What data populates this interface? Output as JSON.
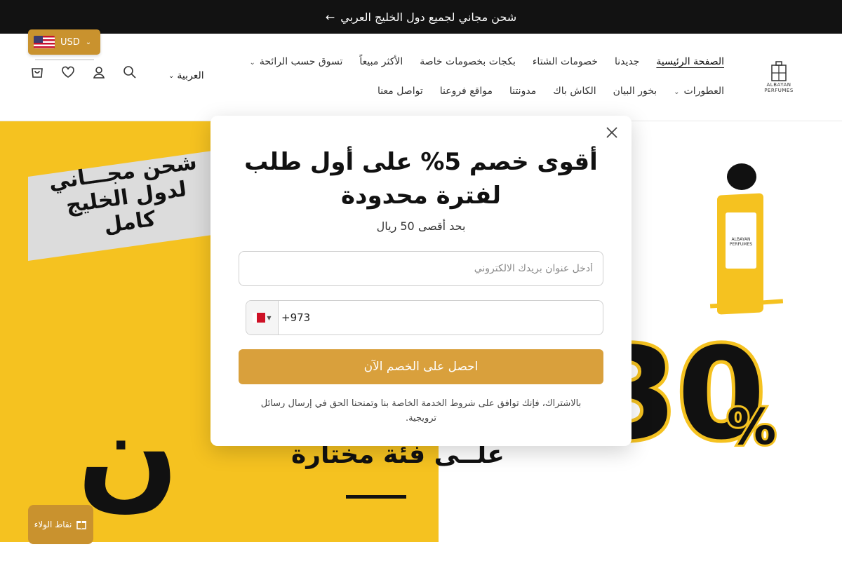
{
  "announcement": {
    "text": "شحن مجاني لجميع دول الخليج العربي",
    "arrow": "→"
  },
  "currency": {
    "code": "USD",
    "flag": "us-flag-icon"
  },
  "language": {
    "label": "العربية"
  },
  "logo": {
    "line1": "ALBAYAN",
    "line2": "PERFUMES"
  },
  "nav": {
    "row1": [
      "الصفحة الرئيسية",
      "جديدنا",
      "خصومات الشتاء",
      "بكجات بخصومات خاصة",
      "الأكثر مبيعاً",
      "تسوق حسب الرائحة"
    ],
    "row2": [
      "العطورات",
      "بخور البيان",
      "الكاش باك",
      "مدونتنا",
      "مواقع فروعنا",
      "تواصل معنا"
    ]
  },
  "hero": {
    "badge_line1": "شحن مجـــاني",
    "badge_line2": "لدول الخليج كامل",
    "big_glyph": "ن",
    "sub": "علــى فئة مختارة",
    "percent": "30",
    "percent_sign": "%",
    "bottle_label": "ALBAYAN PERFUMES"
  },
  "loyalty": {
    "label": "نقاط الولاء"
  },
  "modal": {
    "title": "أقوى خصم 5% على أول طلب لفترة محدودة",
    "subtitle": "بحد أقصى 50 ريال",
    "email_placeholder": "أدخل عنوان بريدك الالكتروني",
    "phone_value": "+973",
    "country": "bahrain-flag-icon",
    "cta": "احصل على الخصم الآن",
    "terms": "بالاشتراك، فإنك توافق على شروط الخدمة الخاصة بنا وتمنحنا الحق في إرسال رسائل ترويجية."
  },
  "colors": {
    "accent": "#d9a03c",
    "gold": "#c9922e",
    "yellow": "#f5c220",
    "dark": "#121212"
  }
}
